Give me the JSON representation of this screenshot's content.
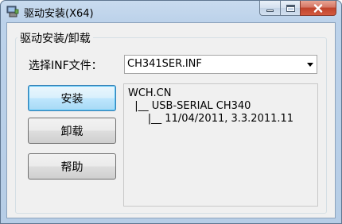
{
  "window": {
    "title": "驱动安装(X64)",
    "icon": "driver-setup-icon"
  },
  "groupbox": {
    "title": "驱动安装/卸载"
  },
  "inf": {
    "label": "选择INF文件：",
    "selected": "CH341SER.INF"
  },
  "buttons": {
    "install": "安装",
    "uninstall": "卸载",
    "help": "帮助"
  },
  "info": {
    "lines": [
      "WCH.CN",
      "  |__ USB-SERIAL CH340",
      "      |__ 11/04/2011, 3.3.2011.11"
    ]
  }
}
